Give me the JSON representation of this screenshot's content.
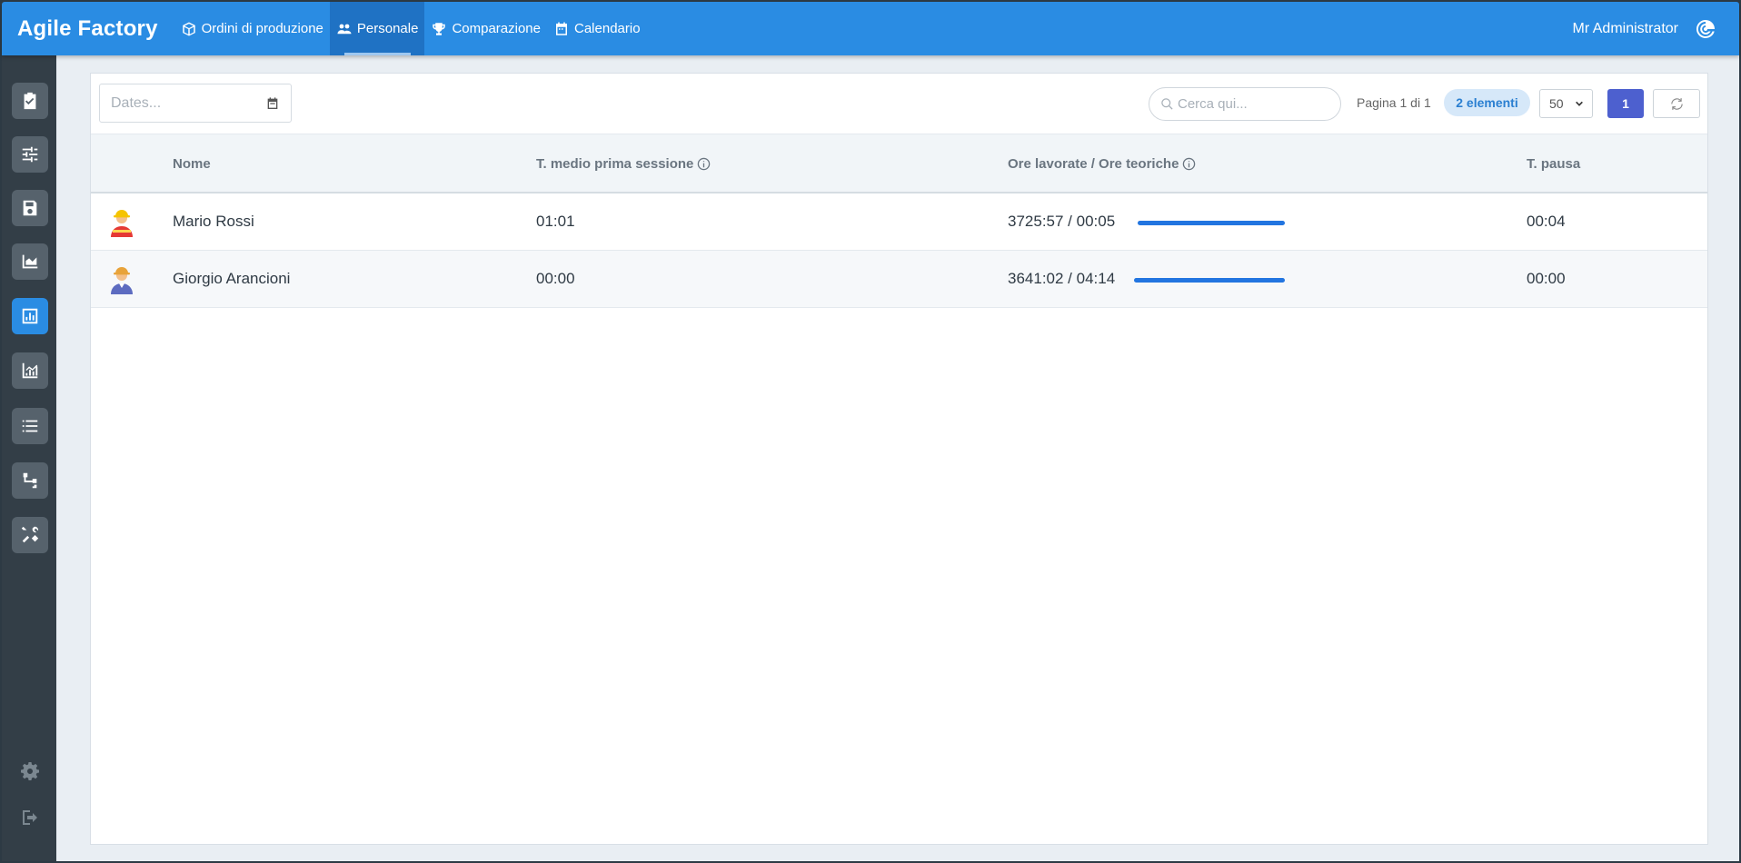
{
  "app": {
    "title": "Agile Factory"
  },
  "nav": [
    {
      "label": "Ordini di produzione",
      "icon": "box-icon",
      "active": false
    },
    {
      "label": "Personale",
      "icon": "users-icon",
      "active": true
    },
    {
      "label": "Comparazione",
      "icon": "trophy-icon",
      "active": false
    },
    {
      "label": "Calendario",
      "icon": "calendar-icon",
      "active": false
    }
  ],
  "user": {
    "name": "Mr Administrator",
    "icon": "user-circle-icon"
  },
  "sidebar": [
    {
      "icon": "clipboard-check-icon",
      "active": false
    },
    {
      "icon": "sliders-icon",
      "active": false
    },
    {
      "icon": "save-icon",
      "active": false
    },
    {
      "icon": "area-chart-icon",
      "active": false
    },
    {
      "icon": "bar-chart-icon",
      "active": true
    },
    {
      "icon": "analytics-chart-icon",
      "active": false
    },
    {
      "icon": "list-icon",
      "active": false
    },
    {
      "icon": "flow-icon",
      "active": false
    },
    {
      "icon": "tools-icon",
      "active": false
    }
  ],
  "sidebar_footer": [
    {
      "icon": "gear-icon"
    },
    {
      "icon": "logout-icon"
    }
  ],
  "toolbar": {
    "dates_placeholder": "Dates...",
    "search_placeholder": "Cerca qui...",
    "page_info": "Pagina 1 di 1",
    "count_badge": "2 elementi",
    "per_page": "50",
    "current_page": "1"
  },
  "table": {
    "columns": [
      "Nome",
      "T. medio prima sessione",
      "Ore lavorate / Ore teoriche",
      "T. pausa"
    ],
    "rows": [
      {
        "name": "Mario Rossi",
        "avg_first_session": "01:01",
        "hours": "3725:57 / 00:05",
        "progress": 1.0,
        "pause": "00:04"
      },
      {
        "name": "Giorgio Arancioni",
        "avg_first_session": "00:00",
        "hours": "3641:02 / 04:14",
        "progress": 1.0,
        "pause": "00:00"
      }
    ]
  },
  "colors": {
    "primary": "#2a8ce3",
    "sidebar": "#333e47",
    "progress": "#2275e0",
    "page_button": "#4d60cf"
  }
}
